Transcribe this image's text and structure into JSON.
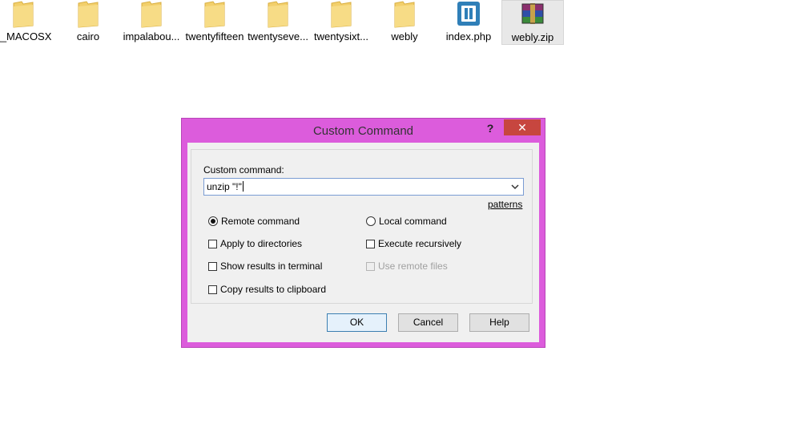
{
  "files": [
    {
      "label": "__MACOSX",
      "icon": "folder-icon"
    },
    {
      "label": "cairo",
      "icon": "folder-icon"
    },
    {
      "label": "impalabou...",
      "icon": "folder-icon"
    },
    {
      "label": "twentyfifteen",
      "icon": "folder-icon"
    },
    {
      "label": "twentyseve...",
      "icon": "folder-icon"
    },
    {
      "label": "twentysixt...",
      "icon": "folder-icon"
    },
    {
      "label": "webly",
      "icon": "folder-icon"
    },
    {
      "label": "index.php",
      "icon": "php-file-icon"
    },
    {
      "label": "webly.zip",
      "icon": "zip-archive-icon"
    }
  ],
  "dialog": {
    "title": "Custom Command",
    "help_glyph": "?",
    "close_glyph": "✕",
    "command_label": "Custom command:",
    "command_value": "unzip \"!\"",
    "patterns_link": "patterns",
    "options": {
      "remote_command": "Remote command",
      "local_command": "Local command",
      "apply_to_directories": "Apply to directories",
      "execute_recursively": "Execute recursively",
      "show_results_in_terminal": "Show results in terminal",
      "use_remote_files": "Use remote files",
      "copy_results_to_clipboard": "Copy results to clipboard"
    },
    "buttons": {
      "ok": "OK",
      "cancel": "Cancel",
      "help": "Help"
    }
  },
  "colors": {
    "window_frame": "#dc5cdc",
    "close_button": "#c7463f",
    "folder": "#f2cf6b"
  }
}
